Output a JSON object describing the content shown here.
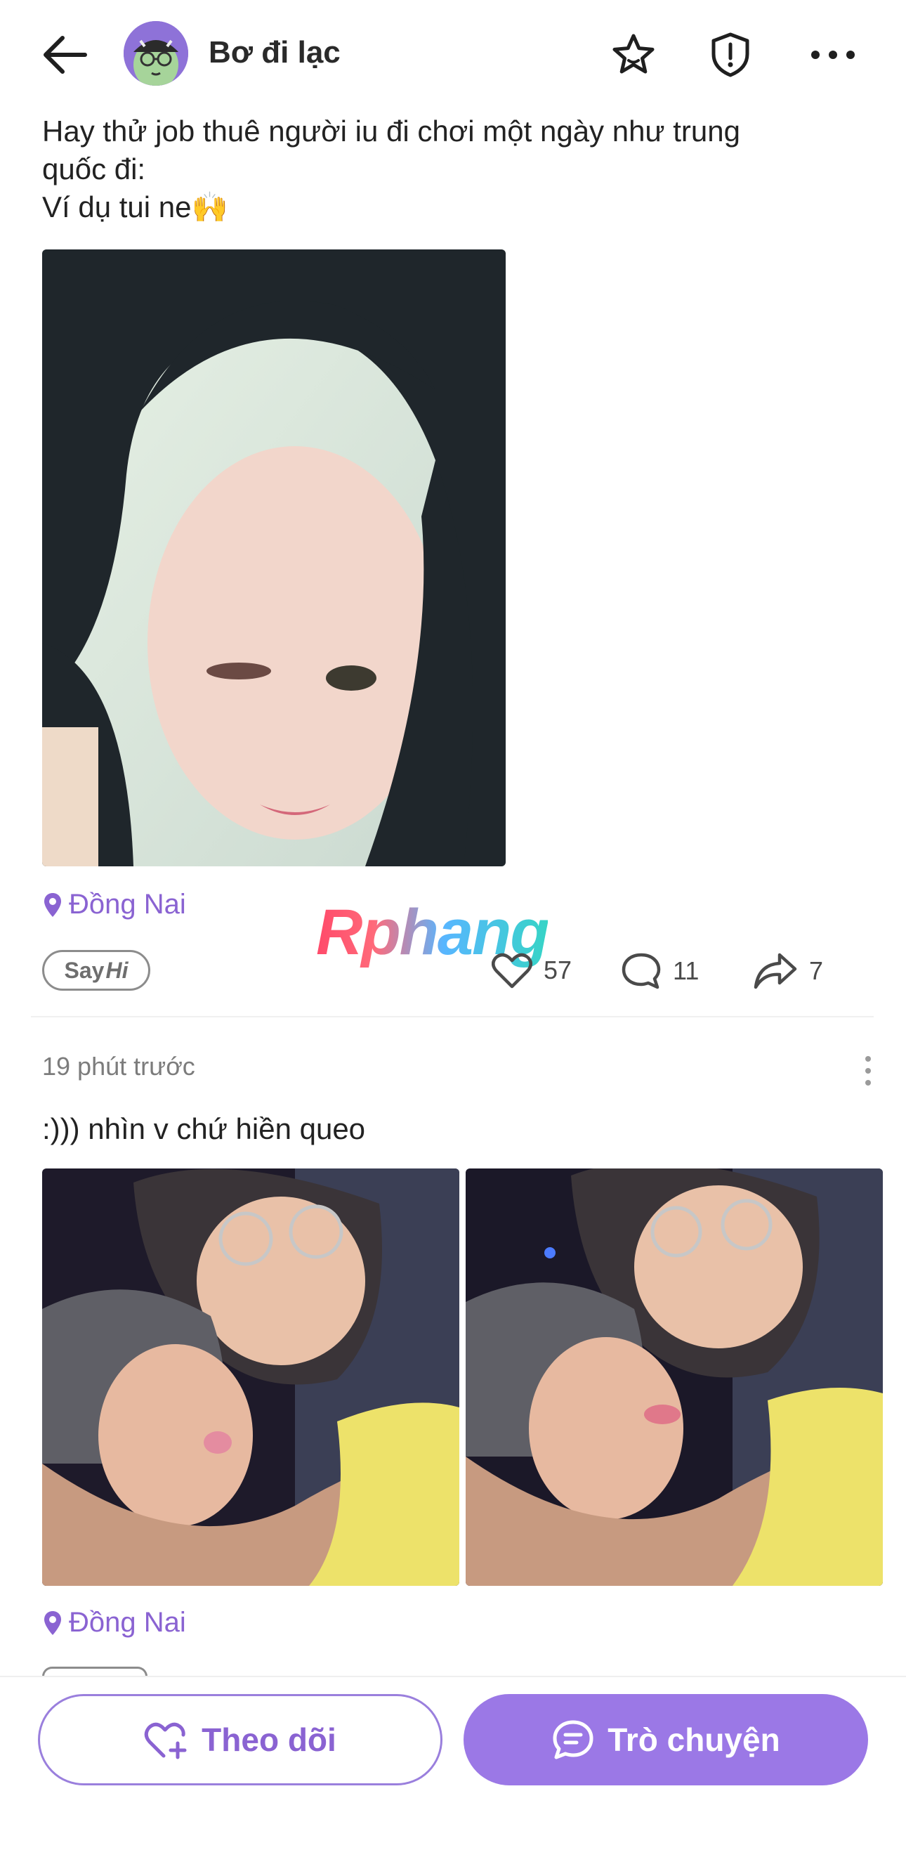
{
  "header": {
    "username": "Bơ đi lạc",
    "icons": [
      "back-arrow-icon",
      "star-icon",
      "report-icon",
      "more-icon"
    ]
  },
  "post1": {
    "text_line1": "Hay thử job thuê người iu đi chơi một ngày như trung",
    "text_line2": "quốc đi:",
    "text_line3": "Ví dụ tui ne🙌",
    "location": "Đồng Nai",
    "sayhi_say": "Say",
    "sayhi_hi": "Hi",
    "likes": "57",
    "comments": "11",
    "shares": "7"
  },
  "watermark": "Rphang",
  "post2": {
    "time": "19 phút trước",
    "text": ":))) nhìn v chứ hiền queo",
    "location": "Đồng Nai"
  },
  "bottom": {
    "follow_label": "Theo dõi",
    "chat_label": "Trò chuyện"
  },
  "colors": {
    "accent": "#8a63d2",
    "accent_fill": "#9b78e6"
  }
}
